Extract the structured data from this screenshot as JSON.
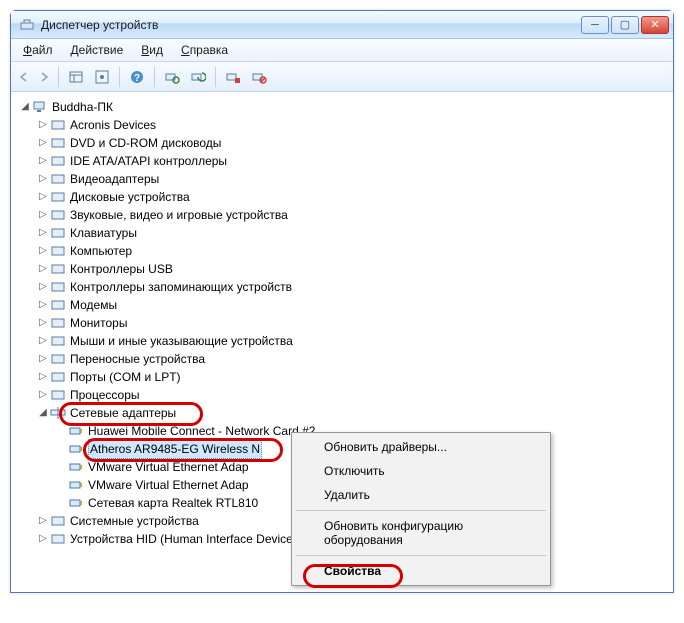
{
  "titlebar": {
    "title": "Диспетчер устройств"
  },
  "menubar": {
    "file": "Файл",
    "action": "Действие",
    "view": "Вид",
    "help": "Справка"
  },
  "tree": {
    "root": "Buddha-ПК",
    "categories": [
      "Acronis Devices",
      "DVD и CD-ROM дисководы",
      "IDE ATA/ATAPI контроллеры",
      "Видеоадаптеры",
      "Дисковые устройства",
      "Звуковые, видео и игровые устройства",
      "Клавиатуры",
      "Компьютер",
      "Контроллеры USB",
      "Контроллеры запоминающих устройств",
      "Модемы",
      "Мониторы",
      "Мыши и иные указывающие устройства",
      "Переносные устройства",
      "Порты (COM и LPT)",
      "Процессоры",
      "Сетевые адаптеры",
      "Системные устройства",
      "Устройства HID (Human Interface Devices)"
    ],
    "network_children": [
      "Huawei Mobile Connect - Network Card #2",
      "Atheros AR9485-EG Wireless N",
      "VMware Virtual Ethernet Adap",
      "VMware Virtual Ethernet Adap",
      "Сетевая карта Realtek RTL810"
    ]
  },
  "contextmenu": {
    "update_drivers": "Обновить драйверы...",
    "disable": "Отключить",
    "delete": "Удалить",
    "scan_hardware": "Обновить конфигурацию оборудования",
    "properties": "Свойства"
  },
  "icons": {
    "minimize": "─",
    "maximize": "▢",
    "close": "✕",
    "twisty_open": "◢",
    "twisty_closed": "▷"
  }
}
